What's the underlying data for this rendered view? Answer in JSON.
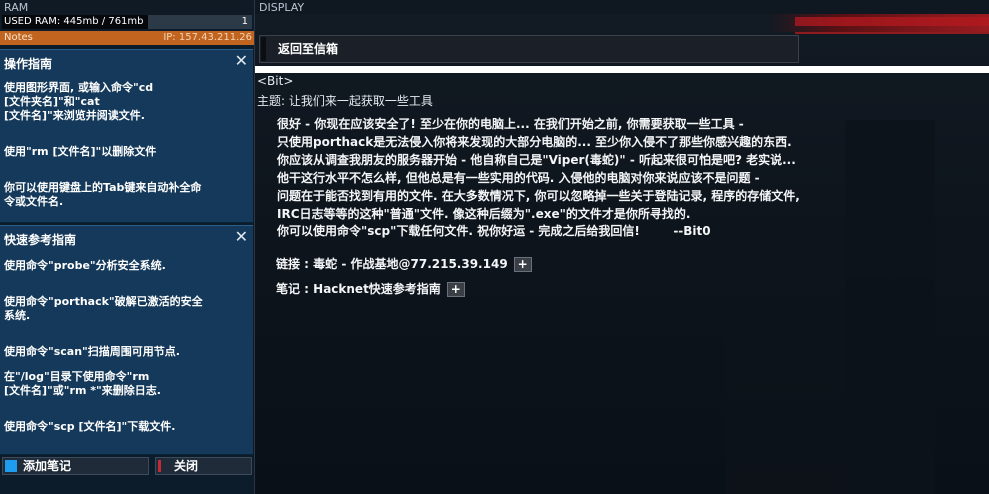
{
  "left": {
    "section_label": "RAM",
    "ram_used_label": "USED RAM: 445mb / 761mb",
    "ram_used_mb": 445,
    "ram_total_mb": 761,
    "ram_process_count": "1",
    "notes_label": "Notes",
    "ip_label": "IP: 157.43.211.26",
    "box1": {
      "title": "操作指南",
      "paragraphs": [
        "使用图形界面, 或输入命令\"cd\n[文件夹名]\"和\"cat\n[文件名]\"来浏览并阅读文件.",
        "使用\"rm [文件名]\"以删除文件",
        "你可以使用键盘上的Tab键来自动补全命\n令或文件名."
      ]
    },
    "box2": {
      "title": "快速参考指南",
      "paragraphs": [
        "使用命令\"probe\"分析安全系统.",
        "使用命令\"porthack\"破解已激活的安全\n系统.",
        "使用命令\"scan\"扫描周围可用节点.",
        "在\"/log\"目录下使用命令\"rm\n[文件名]\"或\"rm *\"来删除日志.",
        "使用命令\"scp [文件名]\"下载文件."
      ]
    },
    "add_note_label": "添加笔记",
    "close_label": "关闭"
  },
  "display": {
    "section_label": "DISPLAY",
    "back_label": "返回至信箱",
    "from": "<Bit>",
    "subject": "主题: 让我们来一起获取一些工具",
    "body_lines": [
      "很好 - 你现在应该安全了! 至少在你的电脑上... 在我们开始之前, 你需要获取一些工具 -",
      "只使用porthack是无法侵入你将来发现的大部分电脑的... 至少你入侵不了那些你感兴趣的东西.",
      "你应该从调查我朋友的服务器开始 - 他自称自己是\"Viper(毒蛇)\" - 听起来很可怕是吧? 老实说...",
      "他干这行水平不怎么样, 但他总是有一些实用的代码. 入侵他的电脑对你来说应该不是问题 -",
      "问题在于能否找到有用的文件. 在大多数情况下, 你可以忽略掉一些关于登陆记录, 程序的存储文件,",
      "IRC日志等等的这种\"普通\"文件. 像这种后缀为\".exe\"的文件才是你所寻找的.",
      "你可以使用命令\"scp\"下载任何文件. 祝你好运 - 完成之后给我回信!        --Bit0"
    ],
    "attachments": [
      {
        "label": "链接 : 毒蛇 - 作战基地@77.215.39.149",
        "button": "+"
      },
      {
        "label": "笔记 : Hacknet快速参考指南",
        "button": "+"
      }
    ]
  }
}
